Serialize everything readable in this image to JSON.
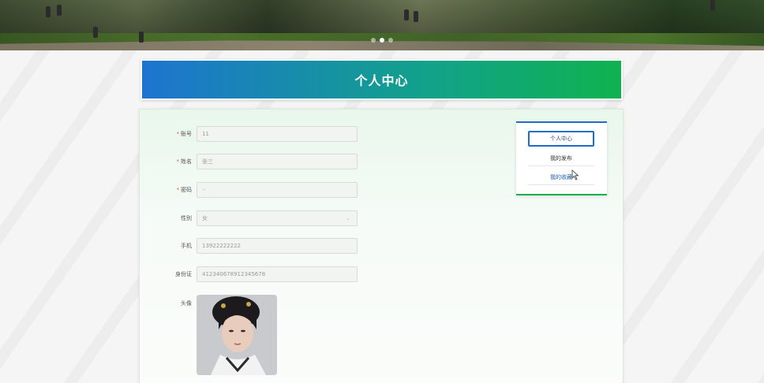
{
  "banner": {
    "carousel_total": 3,
    "carousel_active": 2
  },
  "header": {
    "title": "个人中心"
  },
  "form": {
    "fields": [
      {
        "label": "账号",
        "required": true,
        "value": "11"
      },
      {
        "label": "姓名",
        "required": true,
        "value": "张三"
      },
      {
        "label": "密码",
        "required": true,
        "value": "··"
      },
      {
        "label": "性别",
        "required": false,
        "value": "女",
        "type": "select"
      },
      {
        "label": "手机",
        "required": false,
        "value": "13922222222"
      },
      {
        "label": "身份证",
        "required": false,
        "value": "412340678912345678"
      }
    ],
    "avatar_label": "头像"
  },
  "side_menu": {
    "items": [
      {
        "label": "个人中心",
        "active": true
      },
      {
        "label": "我的发布",
        "active": false
      },
      {
        "label": "我的收藏",
        "active": false
      }
    ]
  },
  "colors": {
    "title_gradient_start": "#1d74d0",
    "title_gradient_end": "#0fb24f",
    "menu_accent_top": "#1d6fc9",
    "menu_accent_bottom": "#19b04b",
    "required_mark": "#e35b5b"
  }
}
